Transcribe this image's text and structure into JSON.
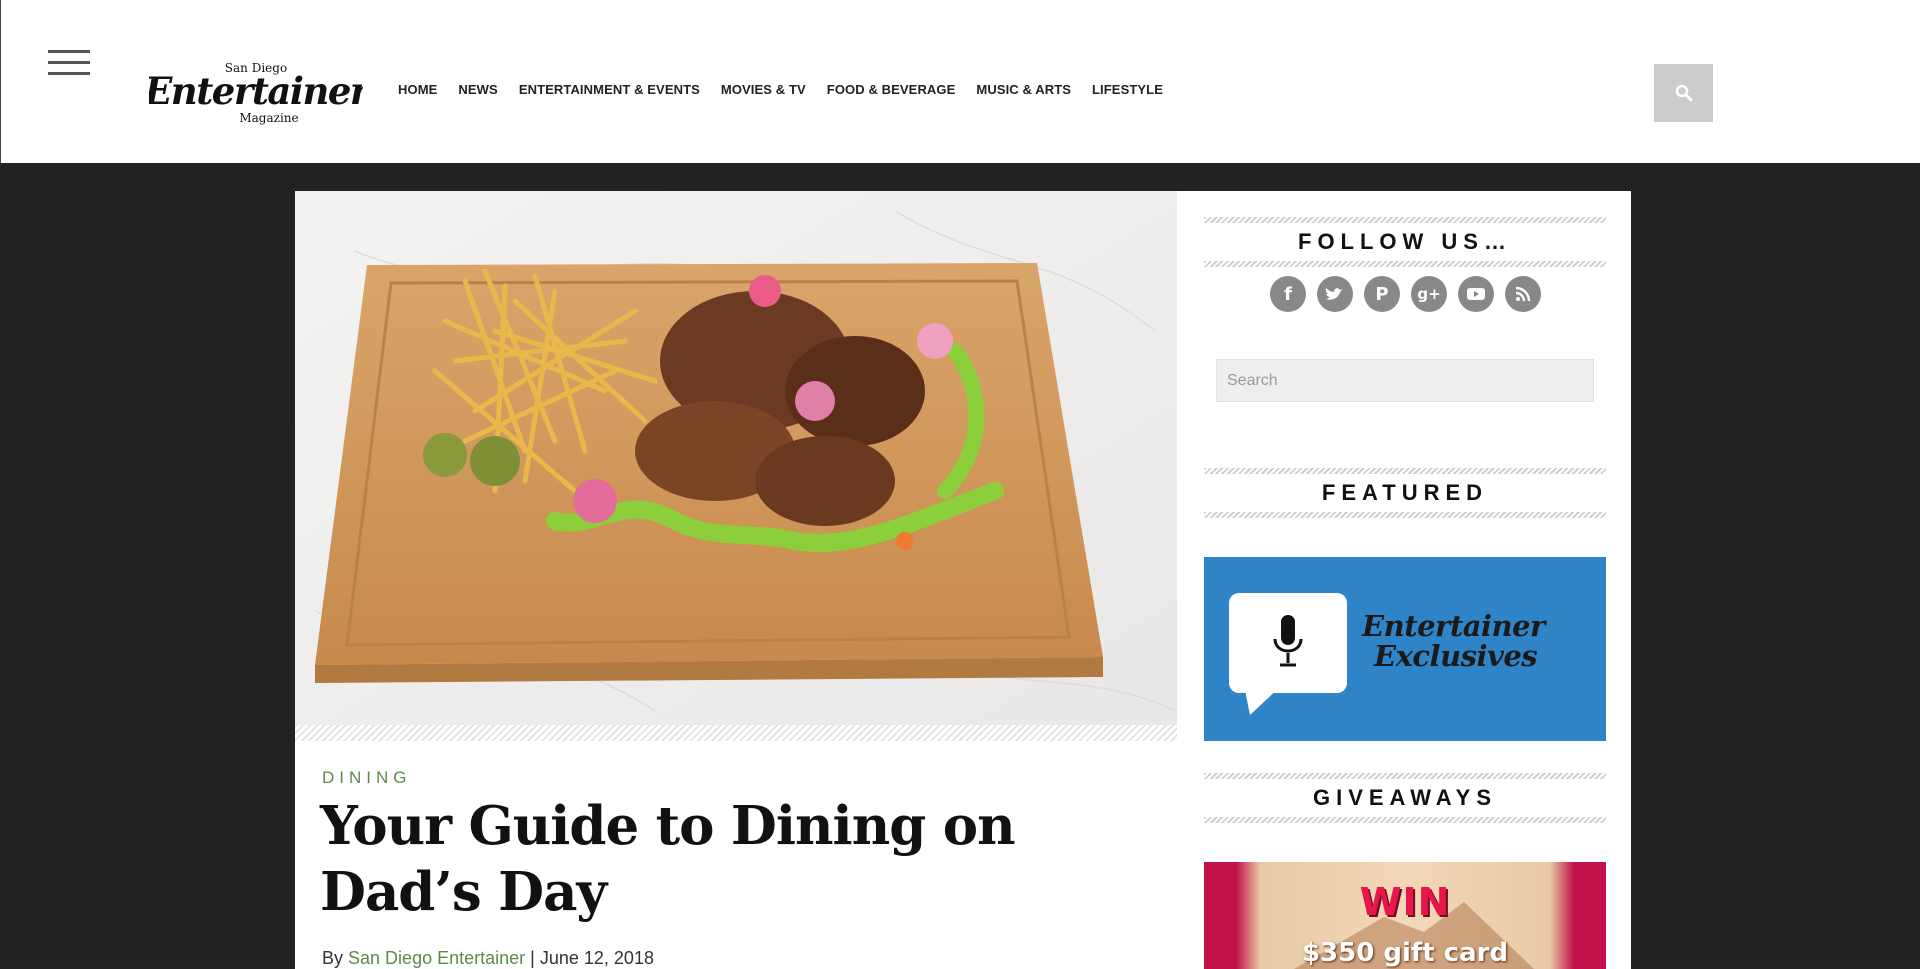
{
  "header": {
    "logo_top": "San Diego",
    "logo_main": "Entertainer",
    "logo_bottom": "Magazine",
    "nav": [
      "HOME",
      "NEWS",
      "ENTERTAINMENT & EVENTS",
      "MOVIES & TV",
      "FOOD & BEVERAGE",
      "MUSIC & ARTS",
      "LIFESTYLE"
    ]
  },
  "article": {
    "category": "DINING",
    "title": "Your Guide to Dining on Dad’s Day",
    "byline_prefix": "By",
    "author": "San Diego Entertainer",
    "separator": "|",
    "date": "June 12, 2018"
  },
  "sidebar": {
    "follow_label": "FOLLOW US…",
    "social_icons": [
      "facebook-icon",
      "twitter-icon",
      "pinterest-icon",
      "google-plus-icon",
      "youtube-icon",
      "rss-icon"
    ],
    "search_placeholder": "Search",
    "featured_label": "FEATURED",
    "featured_line1": "Entertainer",
    "featured_line2": "Exclusives",
    "giveaways_label": "GIVEAWAYS",
    "giveaway_win": "WIN",
    "giveaway_prize": "$350 gift card"
  },
  "colors": {
    "accent_green": "#5c8a4a",
    "featured_blue": "#2f84c8",
    "page_background": "#222222"
  }
}
